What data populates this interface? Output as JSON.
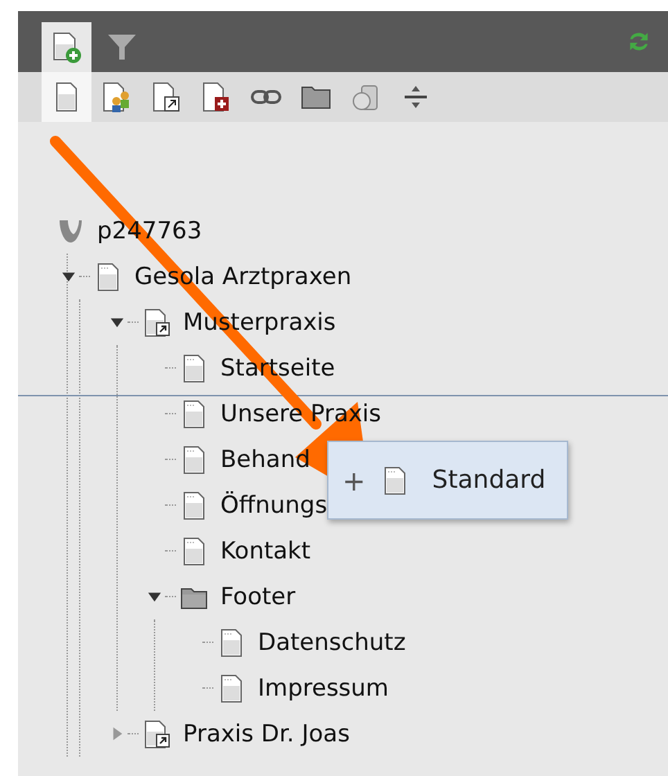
{
  "tabs": [
    {
      "selected": true
    },
    {
      "selected": false
    }
  ],
  "toolbar": [
    {
      "selected": true
    },
    {
      "selected": false
    },
    {
      "selected": false
    },
    {
      "selected": false
    },
    {
      "selected": false
    },
    {
      "selected": false
    },
    {
      "selected": false
    },
    {
      "selected": false
    }
  ],
  "tree": {
    "label": "p247763",
    "kind": "root",
    "children": [
      {
        "label": "Gesola Arztpraxen",
        "kind": "page",
        "expanded": true,
        "children": [
          {
            "label": "Musterpraxis",
            "kind": "shortcut",
            "expanded": true,
            "children": [
              {
                "label": "Startseite",
                "kind": "page"
              },
              {
                "label": "Unsere Praxis",
                "kind": "page"
              },
              {
                "label": "Behand",
                "kind": "page"
              },
              {
                "label": "Öffnungs",
                "kind": "page"
              },
              {
                "label": "Kontakt",
                "kind": "page"
              },
              {
                "label": "Footer",
                "kind": "folder",
                "expanded": true,
                "children": [
                  {
                    "label": "Datenschutz",
                    "kind": "page"
                  },
                  {
                    "label": "Impressum",
                    "kind": "page"
                  }
                ]
              }
            ]
          },
          {
            "label": "Praxis Dr. Joas",
            "kind": "shortcut",
            "expanded": false
          }
        ]
      }
    ]
  },
  "drag_tooltip": {
    "sign": "+",
    "label": "Standard"
  }
}
